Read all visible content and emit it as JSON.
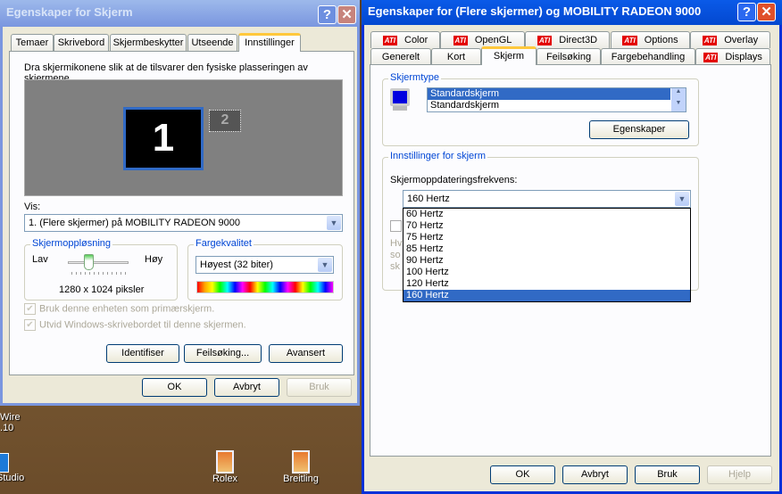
{
  "left_dialog": {
    "title": "Egenskaper for Skjerm",
    "tabs": [
      "Temaer",
      "Skrivebord",
      "Skjermbeskytter",
      "Utseende",
      "Innstillinger"
    ],
    "instruction": "Dra skjermikonene slik at de tilsvarer den fysiske plasseringen av skjermene.",
    "monitors": [
      "1",
      "2"
    ],
    "vis_label": "Vis:",
    "vis_value": "1. (Flere skjermer) på MOBILITY RADEON 9000",
    "resolution": {
      "legend": "Skjermoppløsning",
      "low": "Lav",
      "high": "Høy",
      "value": "1280 x 1024 piksler",
      "slider_fraction": 0.4
    },
    "color": {
      "legend": "Fargekvalitet",
      "value": "Høyest (32 biter)"
    },
    "checkboxes": [
      "Bruk denne enheten som primærskjerm.",
      "Utvid Windows-skrivebordet til denne skjermen."
    ],
    "buttons": [
      "Identifiser",
      "Feilsøking...",
      "Avansert"
    ],
    "footer": [
      "OK",
      "Avbryt",
      "Bruk"
    ]
  },
  "desktop": {
    "icons": [
      "Wire",
      "10",
      "Studio",
      "Rolex",
      "Breitling"
    ]
  },
  "right_dialog": {
    "title": "Egenskaper for (Flere skjermer) og MOBILITY RADEON 9000",
    "ati_logo": "ATI",
    "tabs_row1": [
      "Color",
      "OpenGL",
      "Direct3D",
      "Options",
      "Overlay"
    ],
    "tabs_row2": [
      "Generelt",
      "Kort",
      "Skjerm",
      "Feilsøking",
      "Fargebehandling",
      "Displays"
    ],
    "monitor_type": {
      "legend": "Skjermtype",
      "items": [
        "Standardskjerm",
        "Standardskjerm"
      ],
      "properties_button": "Egenskaper"
    },
    "settings": {
      "legend": "Innstillinger for skjerm",
      "label": "Skjermoppdateringsfrekvens:",
      "value": "160 Hertz",
      "options": [
        "60 Hertz",
        "70 Hertz",
        "75 Hertz",
        "85 Hertz",
        "90 Hertz",
        "100 Hertz",
        "120 Hertz",
        "160 Hertz"
      ],
      "hidden_text": [
        "Hv",
        "so",
        "sk"
      ]
    },
    "footer": [
      "OK",
      "Avbryt",
      "Bruk",
      "Hjelp"
    ]
  }
}
